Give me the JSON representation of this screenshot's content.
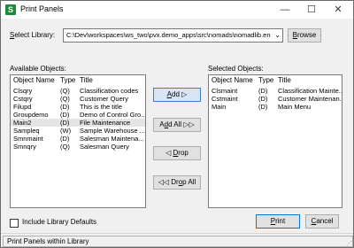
{
  "window": {
    "title": "Print Panels",
    "app_icon": "S"
  },
  "titlebar": {
    "minimize": "—",
    "maximize": "☐",
    "close": "✕"
  },
  "library": {
    "label_prefix": "S",
    "label_rest": "elect Library:",
    "value": "C:\\Dev\\workspaces\\ws_two\\pvx.demo_apps\\src\\nomads\\nomadlib.en",
    "browse_button_prefix": "B",
    "browse_button_rest": "rowse"
  },
  "available": {
    "label": "Available Objects:",
    "columns": [
      "Object Name",
      "Type",
      "Title"
    ],
    "rows": [
      {
        "name": "Clsqry",
        "type": "(Q)",
        "title": "Classification codes"
      },
      {
        "name": "Cstqry",
        "type": "(Q)",
        "title": "Customer Query"
      },
      {
        "name": "Filupd",
        "type": "(D)",
        "title": "This is the title"
      },
      {
        "name": "Groupdemo",
        "type": "(D)",
        "title": "Demo of Control Gro..."
      },
      {
        "name": "Main2",
        "type": "(D)",
        "title": "File Maintenance"
      },
      {
        "name": "Sampleq",
        "type": "(W)",
        "title": "Sample Warehouse ..."
      },
      {
        "name": "Smnmaint",
        "type": "(D)",
        "title": "Salesman Maintena..."
      },
      {
        "name": "Smnqry",
        "type": "(Q)",
        "title": "Salesman Query"
      }
    ]
  },
  "selected": {
    "label": "Selected Objects:",
    "columns": [
      "Object Name",
      "Type",
      "Title"
    ],
    "rows": [
      {
        "name": "Clsmaint",
        "type": "(D)",
        "title": "Classification Mainte..."
      },
      {
        "name": "Cstmaint",
        "type": "(D)",
        "title": "Customer Maintenan..."
      },
      {
        "name": "Main",
        "type": "(D)",
        "title": "Main Menu"
      }
    ]
  },
  "actions": {
    "add_prefix": "A",
    "add_rest": "dd",
    "add_all_prefix": "A",
    "add_all_mid": "d",
    "add_all_rest": "d All",
    "drop_prefix": "D",
    "drop_rest": "rop",
    "drop_all_prefix": "Dr",
    "drop_all_mid": "o",
    "drop_all_rest": "p All",
    "add_icon": "▷",
    "add_all_icon": "▷▷",
    "drop_icon": "◁",
    "drop_all_icon": "◁◁"
  },
  "include_defaults": {
    "label": "Include Library Defaults",
    "checked": false
  },
  "footer": {
    "print_prefix": "P",
    "print_rest": "rint",
    "cancel_prefix": "C",
    "cancel_rest": "ancel"
  },
  "status": {
    "text": "Print Panels within Library"
  }
}
